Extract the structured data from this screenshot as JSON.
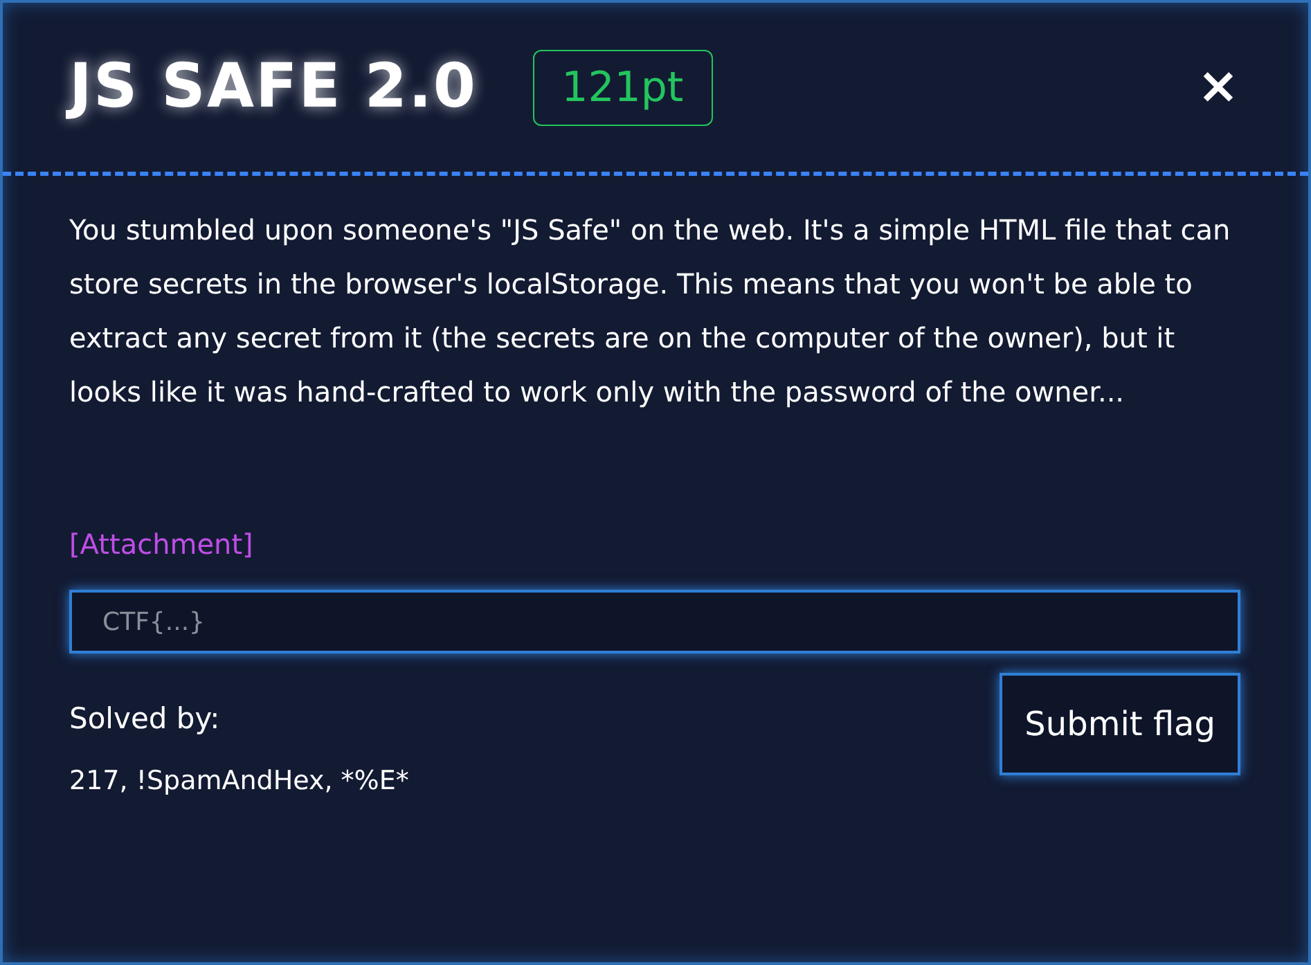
{
  "dialog": {
    "title": "JS SAFE 2.0",
    "points": "121pt",
    "close": "×",
    "description": "You stumbled upon someone's \"JS Safe\" on the web. It's a simple HTML file that can store secrets in the browser's localStorage. This means that you won't be able to extract any secret from it (the secrets are on the computer of the owner), but it looks like it was hand-crafted to work only with the password of the owner...",
    "attachment": "[Attachment]",
    "flag_field": {
      "placeholder": "CTF{...}"
    },
    "solved_by_label": "Solved by:",
    "solved_by": "217, !SpamAndHex, *%E*",
    "submit": "Submit flag"
  }
}
